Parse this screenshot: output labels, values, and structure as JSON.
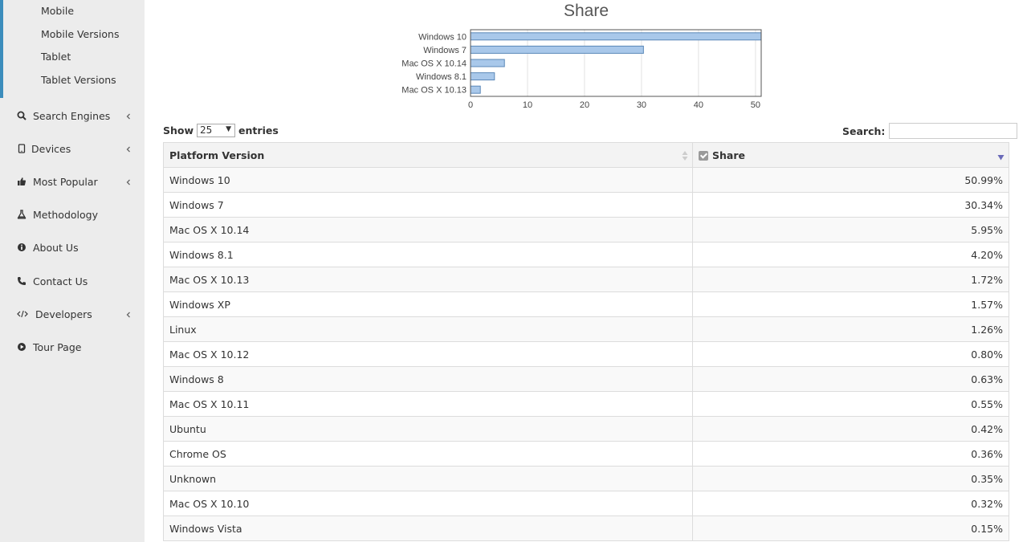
{
  "sidebar": {
    "sub_items": [
      "Mobile",
      "Mobile Versions",
      "Tablet",
      "Tablet Versions"
    ],
    "nav_items": [
      {
        "label": "Search Engines",
        "icon": "search-icon",
        "has_submenu": true
      },
      {
        "label": "Devices",
        "icon": "tablet-icon",
        "has_submenu": true
      },
      {
        "label": "Most Popular",
        "icon": "thumbs-up-icon",
        "has_submenu": true
      },
      {
        "label": "Methodology",
        "icon": "flask-icon",
        "has_submenu": false
      },
      {
        "label": "About Us",
        "icon": "info-icon",
        "has_submenu": false
      },
      {
        "label": "Contact Us",
        "icon": "phone-icon",
        "has_submenu": false
      },
      {
        "label": "Developers",
        "icon": "code-icon",
        "has_submenu": true
      },
      {
        "label": "Tour Page",
        "icon": "play-icon",
        "has_submenu": false
      }
    ],
    "accent_color": "#3c8dbc"
  },
  "chart_data": {
    "type": "bar",
    "orientation": "horizontal",
    "title": "Share",
    "categories": [
      "Windows 10",
      "Windows 7",
      "Mac OS X 10.14",
      "Windows 8.1",
      "Mac OS X 10.13"
    ],
    "values": [
      50.99,
      30.34,
      5.95,
      4.2,
      1.72
    ],
    "xlim": [
      0,
      51
    ],
    "xticks": [
      0,
      10,
      20,
      30,
      40,
      50
    ],
    "grid": true,
    "bar_color": "#a9c8ea",
    "bar_border": "#5b88b8"
  },
  "table": {
    "show_label": "Show",
    "entries_label": "entries",
    "length_value": "25",
    "search_label": "Search:",
    "search_value": "",
    "columns": [
      "Platform Version",
      "Share"
    ],
    "rows": [
      [
        "Windows 10",
        "50.99%"
      ],
      [
        "Windows 7",
        "30.34%"
      ],
      [
        "Mac OS X 10.14",
        "5.95%"
      ],
      [
        "Windows 8.1",
        "4.20%"
      ],
      [
        "Mac OS X 10.13",
        "1.72%"
      ],
      [
        "Windows XP",
        "1.57%"
      ],
      [
        "Linux",
        "1.26%"
      ],
      [
        "Mac OS X 10.12",
        "0.80%"
      ],
      [
        "Windows 8",
        "0.63%"
      ],
      [
        "Mac OS X 10.11",
        "0.55%"
      ],
      [
        "Ubuntu",
        "0.42%"
      ],
      [
        "Chrome OS",
        "0.36%"
      ],
      [
        "Unknown",
        "0.35%"
      ],
      [
        "Mac OS X 10.10",
        "0.32%"
      ],
      [
        "Windows Vista",
        "0.15%"
      ]
    ]
  }
}
